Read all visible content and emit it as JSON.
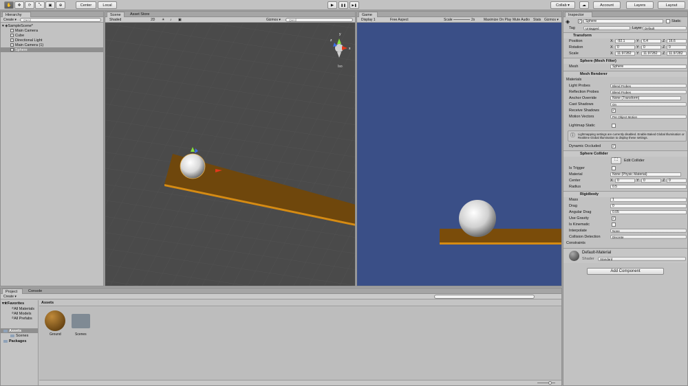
{
  "toolbar": {
    "tools": [
      "✋",
      "✥",
      "⟳",
      "⤡",
      "▣",
      "⊕"
    ],
    "pivot": "Center",
    "space": "Local",
    "play": "▶",
    "pause": "❚❚",
    "step": "▶❚",
    "collab": "Collab ▾",
    "cloud": "☁",
    "account": "Account",
    "layers": "Layers",
    "layout": "Layout"
  },
  "hierarchy": {
    "tab": "Hierarchy",
    "create": "Create ▾",
    "search_placeholder": "Q▾All",
    "scene": "SampleScene*",
    "items": [
      "Main Camera",
      "Cube",
      "Directional Light",
      "Main Camera (1)",
      "Sphere"
    ]
  },
  "scene": {
    "tab": "Scene",
    "tab2": "Asset Store",
    "shading": "Shaded",
    "mode2d": "2D",
    "light": "☀",
    "audio": "♪",
    "fx": "▣",
    "gizmos": "Gizmos ▾",
    "search_placeholder": "Q▾All",
    "persp": "Iso",
    "gizmo_y": "y",
    "gizmo_x": "x",
    "gizmo_z": "z"
  },
  "game": {
    "tab": "Game",
    "display": "Display 1",
    "aspect": "Free Aspect",
    "scale_label": "Scale",
    "scale_value": "2x",
    "maximize": "Maximize On Play",
    "mute": "Mute Audio",
    "stats": "Stats",
    "gizmos": "Gizmos ▾"
  },
  "inspector": {
    "tab": "Inspector",
    "name": "Sphere",
    "static": "Static",
    "tag_label": "Tag",
    "tag": "Untagged",
    "layer_label": "Layer",
    "layer": "Default",
    "transform": {
      "title": "Transform",
      "position_label": "Position",
      "rotation_label": "Rotation",
      "scale_label": "Scale",
      "position": [
        "-92.1",
        "6.4",
        "16.6"
      ],
      "rotation": [
        "0",
        "0",
        "0"
      ],
      "scale": [
        "11.97282",
        "11.97282",
        "11.97282"
      ]
    },
    "mesh_filter": {
      "title": "Sphere (Mesh Filter)",
      "mesh_label": "Mesh",
      "mesh": "Sphere"
    },
    "mesh_renderer": {
      "title": "Mesh Renderer",
      "materials": "Materials",
      "light_probes_label": "Light Probes",
      "light_probes": "Blend Probes",
      "reflection_probes_label": "Reflection Probes",
      "reflection_probes": "Blend Probes",
      "anchor_label": "Anchor Override",
      "anchor": "None (Transform)",
      "cast_label": "Cast Shadows",
      "cast": "On",
      "receive_label": "Receive Shadows",
      "motion_label": "Motion Vectors",
      "motion": "Per Object Motion",
      "lightmap_label": "Lightmap Static",
      "info": "Lightmapping settings are currently disabled. Enable Baked Global Illumination or Realtime Global Illumination to display these settings.",
      "occluded_label": "Dynamic Occluded"
    },
    "collider": {
      "title": "Sphere Collider",
      "edit": "Edit Collider",
      "trigger_label": "Is Trigger",
      "material_label": "Material",
      "material": "None (Physic Material)",
      "center_label": "Center",
      "center": [
        "0",
        "0",
        "0"
      ],
      "radius_label": "Radius",
      "radius": "0.5"
    },
    "rigidbody": {
      "title": "Rigidbody",
      "mass_label": "Mass",
      "mass": "1",
      "drag_label": "Drag",
      "drag": "0",
      "angular_label": "Angular Drag",
      "angular": "0.05",
      "gravity_label": "Use Gravity",
      "kinematic_label": "Is Kinematic",
      "interpolate_label": "Interpolate",
      "interpolate": "None",
      "collision_label": "Collision Detection",
      "collision": "Discrete",
      "constraints": "Constraints"
    },
    "material": {
      "title": "Default-Material",
      "shader_label": "Shader",
      "shader": "Standard"
    },
    "add_component": "Add Component"
  },
  "project": {
    "tab": "Project",
    "tab2": "Console",
    "create": "Create ▾",
    "favorites": "Favorites",
    "fav_items": [
      "All Materials",
      "All Models",
      "All Prefabs"
    ],
    "assets": "Assets",
    "scenes": "Scenes",
    "packages": "Packages",
    "breadcrumb": "Assets",
    "tiles": [
      "Ground",
      "Scenes"
    ]
  },
  "colors": {
    "game_bg": "#3a4f87",
    "plank": "#7a4c0a",
    "plank_edge": "#d68b12",
    "scene_bg": "#4a4a4a"
  }
}
